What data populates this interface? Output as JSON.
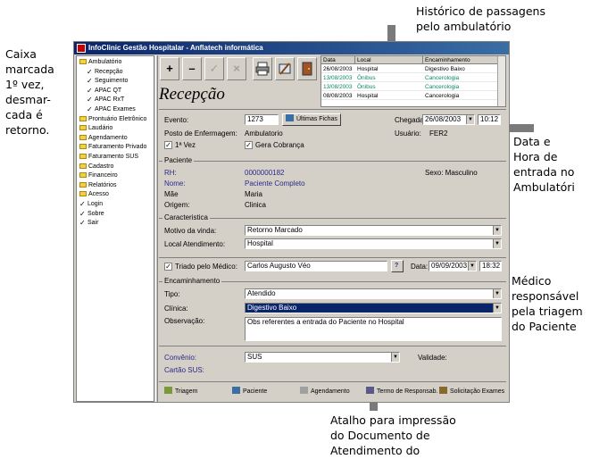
{
  "annotations": {
    "top_line1": "Histórico de passagens",
    "top_line2": "pelo ambulatório",
    "left_lines": [
      "Caixa",
      "marcada",
      "1º vez,",
      "desmar-",
      "cada é",
      "retorno."
    ],
    "right1_lines": [
      "Data e",
      "Hora de",
      "entrada no",
      "Ambulatóri"
    ],
    "right2_lines": [
      "Médico",
      "responsável",
      "pela triagem",
      "do Paciente"
    ],
    "bottom_lines": [
      "Atalho para impressão",
      "do Documento de",
      "Atendimento do"
    ]
  },
  "window": {
    "title": "InfoClinic Gestão Hospitalar - Anflatech informática"
  },
  "tree": [
    {
      "label": "Ambulatório",
      "kind": "folder",
      "indent": 0
    },
    {
      "label": "Recepção",
      "kind": "check",
      "indent": 1
    },
    {
      "label": "Seguimento",
      "kind": "check",
      "indent": 1
    },
    {
      "label": "APAC QT",
      "kind": "check",
      "indent": 1
    },
    {
      "label": "APAC RxT",
      "kind": "check",
      "indent": 1
    },
    {
      "label": "APAC Exames",
      "kind": "check",
      "indent": 1
    },
    {
      "label": "Prontuário Eletrônico",
      "kind": "folder",
      "indent": 0
    },
    {
      "label": "Laudário",
      "kind": "folder",
      "indent": 0
    },
    {
      "label": "Agendamento",
      "kind": "folder",
      "indent": 0
    },
    {
      "label": "Faturamento Privado",
      "kind": "folder",
      "indent": 0
    },
    {
      "label": "Faturamento SUS",
      "kind": "folder",
      "indent": 0
    },
    {
      "label": "Cadastro",
      "kind": "folder",
      "indent": 0
    },
    {
      "label": "Financeiro",
      "kind": "folder",
      "indent": 0
    },
    {
      "label": "Relatórios",
      "kind": "folder",
      "indent": 0
    },
    {
      "label": "Acesso",
      "kind": "folder",
      "indent": 0
    },
    {
      "label": "Login",
      "kind": "check",
      "indent": 0
    },
    {
      "label": "Sobre",
      "kind": "check",
      "indent": 0
    },
    {
      "label": "Sair",
      "kind": "check",
      "indent": 0
    }
  ],
  "toolbar": {
    "add": "+",
    "remove": "–",
    "confirm": "✓",
    "cancel": "×"
  },
  "page_title": "Recepção",
  "history": {
    "headers": [
      "Data",
      "Local",
      "Encaminhamento"
    ],
    "rows": [
      {
        "date": "26/08/2003",
        "place": "Hospital",
        "dest": "Digestivo Baixo",
        "color": "#000000"
      },
      {
        "date": "13/08/2003",
        "place": "Ônibus",
        "dest": "Cancerologia",
        "color": "#0a8a6a"
      },
      {
        "date": "13/08/2003",
        "place": "Ônibus",
        "dest": "Cancerologia",
        "color": "#0a8a6a"
      },
      {
        "date": "08/08/2003",
        "place": "Hospital",
        "dest": "Cancerologia",
        "color": "#000000"
      }
    ]
  },
  "evento": {
    "label": "Evento:",
    "value": "1273",
    "ultimas_fichas": "Últimas Fichas",
    "chegada_label": "Chegada:",
    "chegada_date": "26/08/2003",
    "chegada_time": "10:12",
    "posto_label": "Posto de Enfermagem:",
    "posto_value": "Ambulatorio",
    "usuario_label": "Usuário:",
    "usuario_value": "FER2",
    "primeira_vez": "1ª Vez",
    "gera_cobranca": "Gera Cobrança"
  },
  "paciente": {
    "title": "Paciente",
    "rh_label": "RH:",
    "rh_value": "0000000182",
    "sexo": "Sexo: Masculino",
    "nome_label": "Nome:",
    "nome_value": "Paciente Completo",
    "mae_label": "Mãe",
    "mae_value": "Maria",
    "origem_label": "Origem:",
    "origem_value": "Clinica"
  },
  "caracteristica": {
    "title": "Caracteristica",
    "motivo_label": "Motivo da vinda:",
    "motivo_value": "Retorno Marcado",
    "local_label": "Local Atendimento:",
    "local_value": "Hospital"
  },
  "triado": {
    "label": "Triado pelo Médico:",
    "value": "Carlos Augusto Véo",
    "help": "?",
    "data_label": "Data:",
    "date": "09/09/2003",
    "time": "18:32"
  },
  "encaminhamento": {
    "title": "Encaminhamento",
    "tipo_label": "Tipo:",
    "tipo_value": "Atendido",
    "clinica_label": "Clínica:",
    "clinica_value": "Digestivo Baixo",
    "obs_label": "Observação:",
    "obs_value": "Obs referentes a entrada do Paciente no Hospital"
  },
  "convenio": {
    "label": "Convênio:",
    "value": "SUS",
    "validade": "Validade:",
    "cartao": "Cartão SUS:"
  },
  "bottom_buttons": [
    "Triagem",
    "Paciente",
    "Agendamento",
    "Termo de Responsab.",
    "Solicitação Exames"
  ]
}
